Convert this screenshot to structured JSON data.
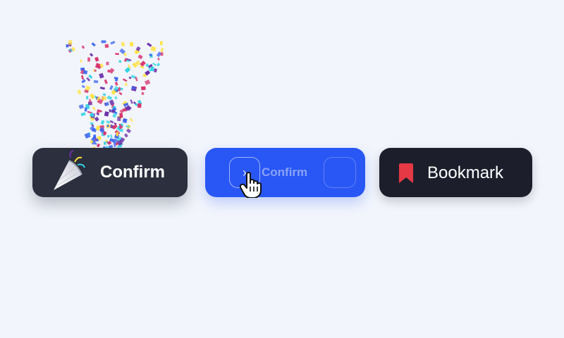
{
  "buttons": {
    "confirm": {
      "label": "Confirm",
      "icon": "party-popper-icon"
    },
    "slide_confirm": {
      "label": "Confirm",
      "handle_glyph": "›",
      "icon": "chevron-right-icon"
    },
    "bookmark": {
      "label": "Bookmark",
      "icon": "bookmark-icon"
    }
  },
  "colors": {
    "background": "#f2f5fc",
    "confirm_bg": "#2c2f3d",
    "slide_bg": "#2957f5",
    "bookmark_bg": "#1c1f2b",
    "bookmark_icon": "#e53945",
    "confetti": [
      "#d7336b",
      "#6a2fa8",
      "#2fd3e4",
      "#ffe23d",
      "#3a64f0"
    ]
  },
  "cursor": {
    "icon": "hand-pointer-icon"
  }
}
